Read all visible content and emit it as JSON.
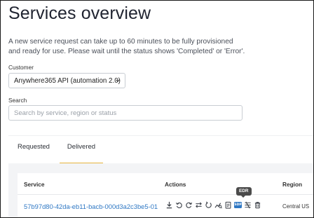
{
  "page": {
    "title": "Services overview",
    "intro": "A new service request can take up to 60 minutes to be fully provisioned and ready for use. Please wait until the status shows 'Completed' or 'Error'."
  },
  "customer": {
    "label": "Customer",
    "selected": "Anywhere365 API (automation 2.0)"
  },
  "search": {
    "label": "Search",
    "placeholder": "Search by service, region or status"
  },
  "tabs": [
    {
      "label": "Requested",
      "active": false
    },
    {
      "label": "Delivered",
      "active": true
    }
  ],
  "table": {
    "headers": {
      "service": "Service",
      "actions": "Actions",
      "region": "Region"
    },
    "rows": [
      {
        "service": "57b97d80-42da-eb11-bacb-000d3a2c3be5-01",
        "region": "Central US"
      }
    ],
    "action_icons": [
      "download-icon",
      "undo-icon",
      "refresh-icon",
      "swap-icon",
      "restore-icon",
      "analytics-icon",
      "document-icon",
      "sdp-icon",
      "split-icon",
      "trash-icon"
    ],
    "sdp_badge": "SDP"
  },
  "tooltip": {
    "text": "EDR"
  },
  "colors": {
    "link": "#2f78c4",
    "tab_active_underline": "#e7b53c",
    "tooltip_bg": "#4b4b4b"
  }
}
